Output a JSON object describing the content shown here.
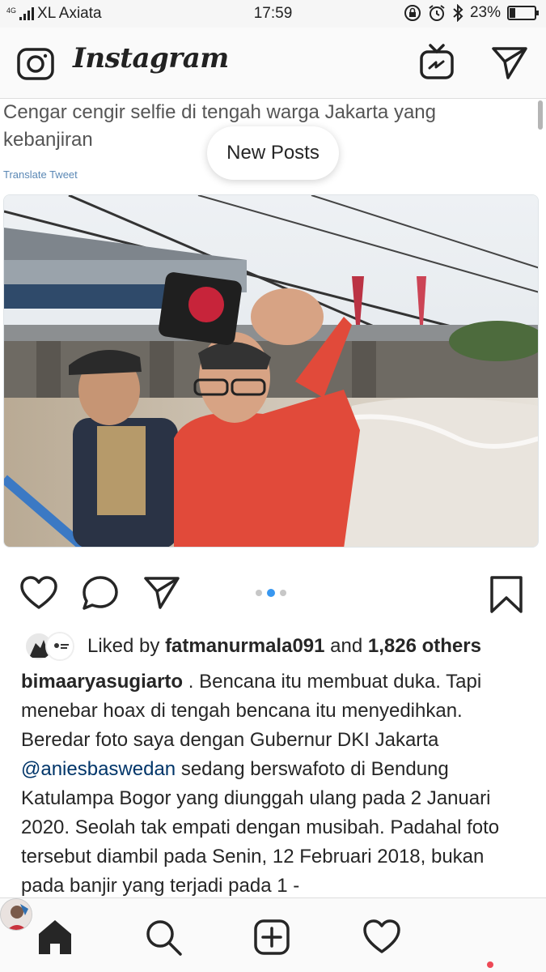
{
  "status_bar": {
    "network": "4G",
    "carrier": "XL Axiata",
    "time": "17:59",
    "battery_percent_label": "23%",
    "battery_level": 0.23
  },
  "header": {
    "logo": "Instagram",
    "icons": [
      "camera-icon",
      "igtv-icon",
      "direct-message-icon"
    ]
  },
  "post": {
    "tweet_text": "Cengar cengir selfie di tengah warga Jakarta yang kebanjiran",
    "translate_label": "Translate Tweet",
    "new_posts_label": "New Posts",
    "carousel": {
      "count": 3,
      "active_index": 1
    },
    "likes": {
      "prefix": "Liked by ",
      "user": "fatmanurmala091",
      "middle": " and ",
      "others": "1,826 others"
    },
    "caption": {
      "username": "bimaaryasugiarto",
      "text_part1": " . Bencana itu membuat duka. Tapi menebar hoax di tengah bencana itu menyedihkan. Beredar foto saya dengan Gubernur DKI Jakarta ",
      "mention": "@aniesbaswedan",
      "text_part2": " sedang berswafoto di Bendung Katulampa Bogor yang diunggah ulang pada 2 Januari 2020. Seolah tak empati dengan musibah. Padahal foto tersebut diambil pada Senin, 12 Februari 2018, bukan pada banjir yang terjadi pada 1 -"
    }
  },
  "bottom_nav": {
    "items": [
      "home-icon",
      "search-icon",
      "add-post-icon",
      "activity-heart-icon",
      "profile-avatar"
    ],
    "active": "home-icon",
    "notification_color": "#ed4956"
  },
  "colors": {
    "accent": "#3897f0",
    "mention": "#003569",
    "text": "#262626"
  }
}
